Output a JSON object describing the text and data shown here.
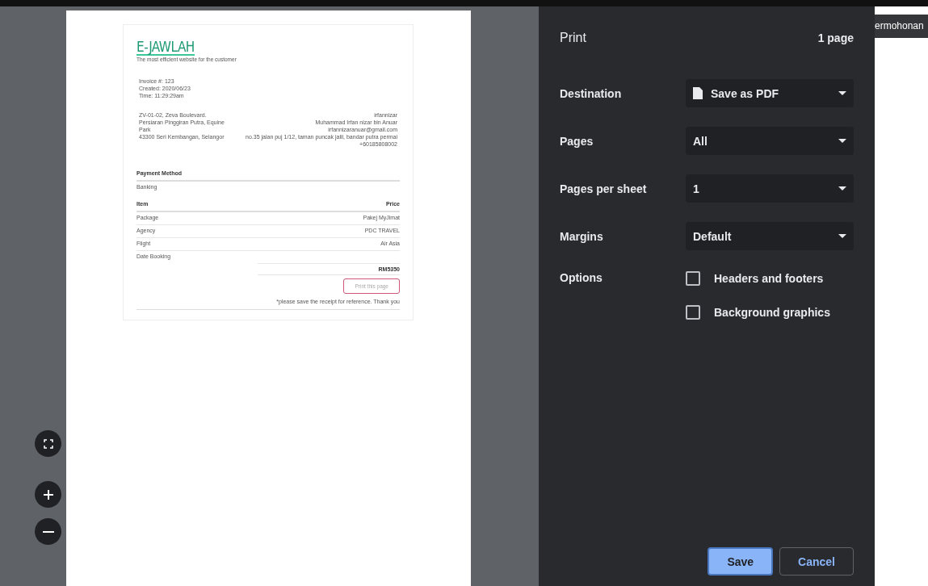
{
  "invoice": {
    "brand": "E-JAWLAH",
    "tagline": "The most efficient website for the customer",
    "meta": [
      "Invoice #: 123",
      "Created: 2020/06/23",
      "Time: 11:29:29am"
    ],
    "from": [
      "ZV-01-02, Zeva Boulevard.",
      "Persiaran Pinggiran Putra, Equine",
      "Park",
      "43300 Seri Kembangan, Selangor"
    ],
    "to": [
      "irfannizar",
      "Muhammad Irfan nizar bin Anuar",
      "irfannizaranuar@gmail.com",
      "no.35 jalan puj 1/12, taman puncak jalil, bandar putra permai",
      "+60185808002"
    ],
    "payment_heading": "Payment Method",
    "payment_value": "Banking",
    "columns": [
      "Item",
      "Price"
    ],
    "rows": [
      {
        "item": "Package",
        "price": "Pakej MyJimat"
      },
      {
        "item": "Agency",
        "price": "PDC TRAVEL"
      },
      {
        "item": "Flight",
        "price": "Air Asia"
      },
      {
        "item": "Date Booking",
        "price": ""
      }
    ],
    "total": "RM5350",
    "print_button": "Print this page",
    "note": "*please save the receipt for reference. Thank you"
  },
  "print": {
    "title": "Print",
    "page_count": "1 page",
    "settings": [
      {
        "label": "Destination",
        "value": "Save as PDF",
        "icon": true
      },
      {
        "label": "Pages",
        "value": "All",
        "icon": false
      },
      {
        "label": "Pages per sheet",
        "value": "1",
        "icon": false
      },
      {
        "label": "Margins",
        "value": "Default",
        "icon": false
      }
    ],
    "options_label": "Options",
    "options": [
      {
        "label": "Headers and footers",
        "checked": false
      },
      {
        "label": "Background graphics",
        "checked": false
      }
    ],
    "buttons": [
      {
        "label": "Save",
        "kind": "primary"
      },
      {
        "label": "Cancel",
        "kind": "secondary"
      }
    ]
  },
  "background_tab": "ermohonan"
}
